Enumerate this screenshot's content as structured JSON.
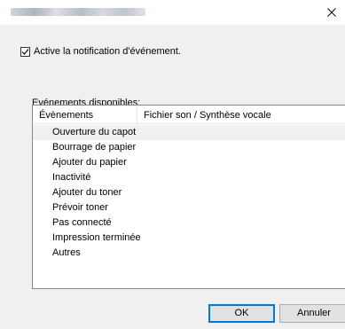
{
  "window": {
    "title_redacted": true
  },
  "notification": {
    "checkbox_label": "Active la notification d'événement.",
    "checked": true
  },
  "events_group": {
    "label": "Evénements disponibles:",
    "columns": [
      "Évènements",
      "Fichier son / Synthèse vocale"
    ],
    "selected_index": 0,
    "rows": [
      {
        "event": "Ouverture du capot",
        "sound": ""
      },
      {
        "event": "Bourrage de papier",
        "sound": ""
      },
      {
        "event": "Ajouter du papier",
        "sound": ""
      },
      {
        "event": "Inactivité",
        "sound": ""
      },
      {
        "event": "Ajouter du toner",
        "sound": ""
      },
      {
        "event": "Prévoir toner",
        "sound": ""
      },
      {
        "event": "Pas connecté",
        "sound": ""
      },
      {
        "event": "Impression terminée",
        "sound": ""
      },
      {
        "event": "Autres",
        "sound": ""
      }
    ]
  },
  "buttons": {
    "ok": "OK",
    "cancel": "Annuler"
  },
  "icons": {
    "close": "close-icon",
    "checkmark": "checkmark-icon"
  },
  "colors": {
    "accent_border": "#0078d7",
    "selected_row": "#f0f0f0",
    "dialog_background": "#f0f0f0"
  }
}
